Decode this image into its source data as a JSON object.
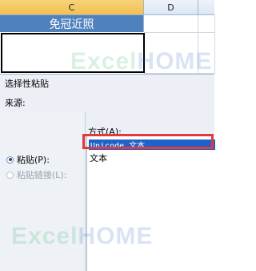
{
  "sheet": {
    "columns": [
      "C",
      "D"
    ],
    "title_cell": "免冠近照",
    "watermark": "ExcelHOME"
  },
  "dialog": {
    "title": "选择性粘贴",
    "source_label": "来源:",
    "paste_label": "粘贴(P):",
    "paste_link_label": "粘贴链接(L):",
    "format_label": "方式(A):",
    "list_items": [
      "Unicode 文本",
      "文本"
    ],
    "selected_index": 0
  },
  "colors": {
    "title_fill": "#4f81bd",
    "selection_fill": "#1f62c8",
    "highlight_border": "#e0393e"
  }
}
